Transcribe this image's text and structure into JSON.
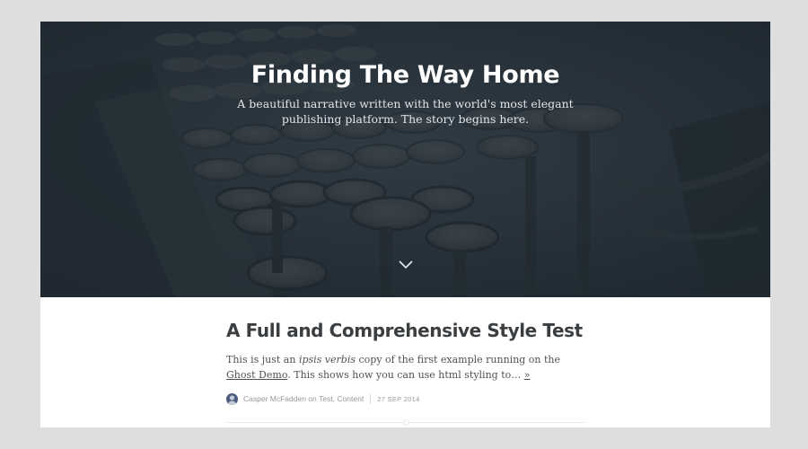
{
  "hero": {
    "title": "Finding The Way Home",
    "description": "A beautiful narrative written with the world's most elegant publishing platform. The story begins here."
  },
  "post": {
    "title": "A Full and Comprehensive Style Test",
    "excerpt_part1": "This is just an ",
    "excerpt_emphasis": "ipsis verbis",
    "excerpt_part2": " copy of the first example running on the ",
    "excerpt_link": "Ghost Demo",
    "excerpt_part3": ". This shows how you can use html styling to…",
    "read_more": "»",
    "author": "Casper McFadden",
    "on_text": " on ",
    "tag1": "Test",
    "tag_separator": ", ",
    "tag2": "Content",
    "date": "27 SEP 2014"
  },
  "icons": {
    "scroll": "chevron-down-icon",
    "avatar": "author-avatar"
  },
  "colors": {
    "hero_overlay": "#263039",
    "title_text": "#3b3e41",
    "meta_text": "#95989b"
  }
}
